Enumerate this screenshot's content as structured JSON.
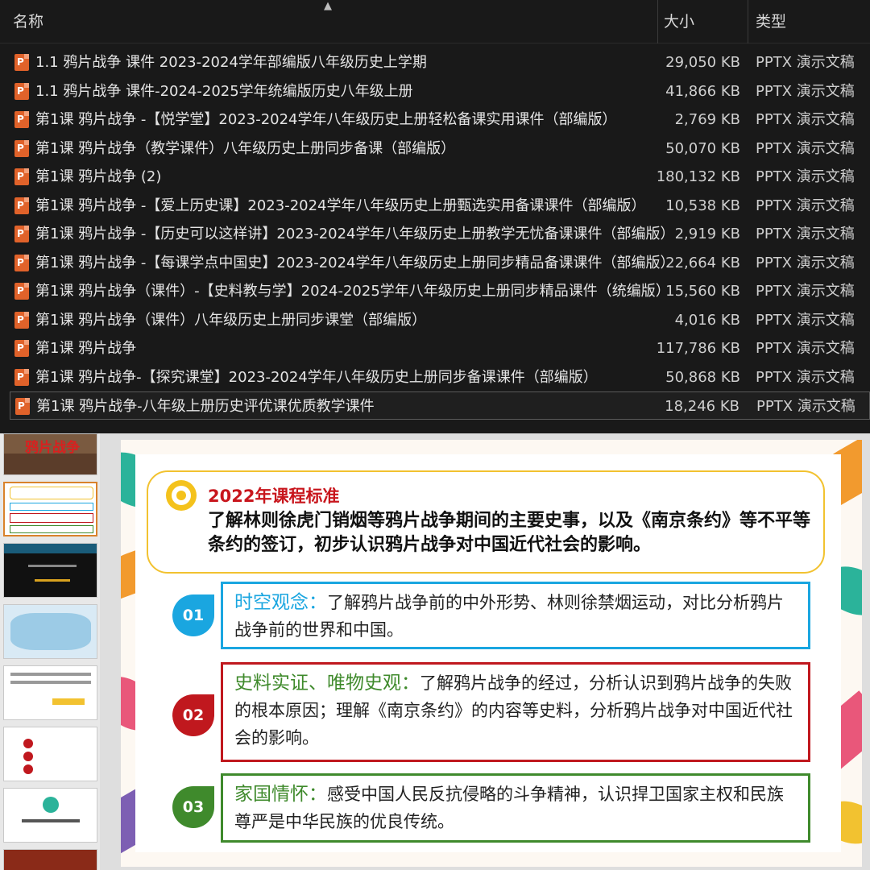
{
  "explorer": {
    "columns": {
      "name": "名称",
      "size": "大小",
      "type": "类型"
    },
    "files": [
      {
        "name": "1.1 鸦片战争 课件 2023-2024学年部编版八年级历史上学期",
        "size": "29,050 KB",
        "type": "PPTX 演示文稿"
      },
      {
        "name": "1.1 鸦片战争 课件-2024-2025学年统编版历史八年级上册",
        "size": "41,866 KB",
        "type": "PPTX 演示文稿"
      },
      {
        "name": "第1课  鸦片战争 -【悦学堂】2023-2024学年八年级历史上册轻松备课实用课件（部编版）",
        "size": "2,769 KB",
        "type": "PPTX 演示文稿"
      },
      {
        "name": "第1课  鸦片战争（教学课件）八年级历史上册同步备课（部编版）",
        "size": "50,070 KB",
        "type": "PPTX 演示文稿"
      },
      {
        "name": "第1课 鸦片战争 (2)",
        "size": "180,132 KB",
        "type": "PPTX 演示文稿"
      },
      {
        "name": "第1课 鸦片战争 -【爱上历史课】2023-2024学年八年级历史上册甄选实用备课课件（部编版）",
        "size": "10,538 KB",
        "type": "PPTX 演示文稿"
      },
      {
        "name": "第1课 鸦片战争 -【历史可以这样讲】2023-2024学年八年级历史上册教学无忧备课课件（部编版）",
        "size": "2,919 KB",
        "type": "PPTX 演示文稿"
      },
      {
        "name": "第1课 鸦片战争 -【每课学点中国史】2023-2024学年八年级历史上册同步精品备课课件（部编版）",
        "size": "22,664 KB",
        "type": "PPTX 演示文稿"
      },
      {
        "name": "第1课 鸦片战争（课件）-【史料教与学】2024-2025学年八年级历史上册同步精品课件（统编版）",
        "size": "15,560 KB",
        "type": "PPTX 演示文稿"
      },
      {
        "name": "第1课 鸦片战争（课件）八年级历史上册同步课堂（部编版）",
        "size": "4,016 KB",
        "type": "PPTX 演示文稿"
      },
      {
        "name": "第1课 鸦片战争",
        "size": "117,786 KB",
        "type": "PPTX 演示文稿"
      },
      {
        "name": "第1课 鸦片战争-【探究课堂】2023-2024学年八年级历史上册同步备课课件（部编版）",
        "size": "50,868 KB",
        "type": "PPTX 演示文稿"
      },
      {
        "name": "第1课 鸦片战争-八年级上册历史评优课优质教学课件",
        "size": "18,246 KB",
        "type": "PPTX 演示文稿"
      }
    ],
    "file_icon": "pptx-file-icon",
    "file_icon_letter": "P"
  },
  "thumbnails": {
    "first_title": "鸦片战争"
  },
  "slide": {
    "standard_title": "2022年课程标准",
    "standard_text": "了解林则徐虎门销烟等鸦片战争期间的主要史事，以及《南京条约》等不平等条约的签订，初步认识鸦片战争对中国近代社会的影响。",
    "items": [
      {
        "num": "01",
        "head": "时空观念：",
        "text": "了解鸦片战争前的中外形势、林则徐禁烟运动，对比分析鸦片战争前的世界和中国。",
        "color": "#1aa6e0"
      },
      {
        "num": "02",
        "head": "史料实证、唯物史观：",
        "text": "了解鸦片战争的经过，分析认识到鸦片战争的失败的根本原因；理解《南京条约》的内容等史料，分析鸦片战争对中国近代社会的影响。",
        "color": "#c0181e"
      },
      {
        "num": "03",
        "head": "家国情怀：",
        "text": "感受中国人民反抗侵略的斗争精神，认识捍卫国家主权和民族尊严是中华民族的优良传统。",
        "color": "#3f8a2c"
      }
    ]
  }
}
